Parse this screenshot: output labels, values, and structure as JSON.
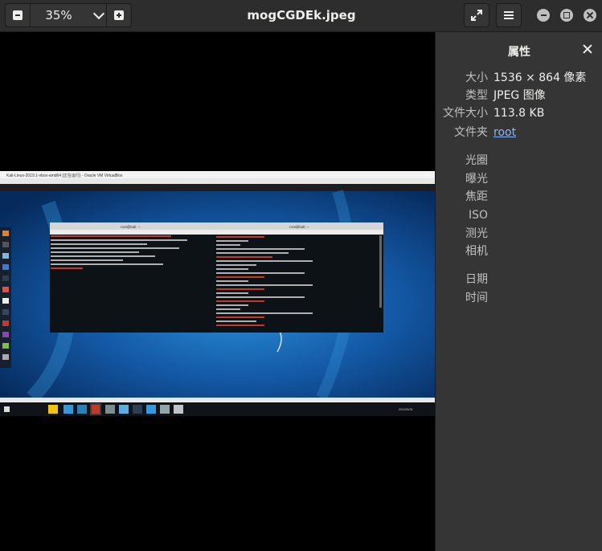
{
  "header": {
    "zoom_value": "35%",
    "title": "mogCGDEk.jpeg"
  },
  "sidebar": {
    "title": "属性",
    "props": [
      {
        "key": "大小",
        "value": "1536 × 864 像素"
      },
      {
        "key": "类型",
        "value": "JPEG 图像"
      },
      {
        "key": "文件大小",
        "value": "113.8 KB"
      },
      {
        "key": "文件夹",
        "value": "root"
      }
    ],
    "exif": [
      "光圈",
      "曝光",
      "焦距",
      "ISO",
      "测光",
      "相机"
    ],
    "time": [
      "日期",
      "时间"
    ]
  },
  "screenshot": {
    "vm_title": "Kali-Linux-2019.1-vbox-amd64 [正在运行] - Oracle VM VirtualBox",
    "term1_title": "root@kali: ~",
    "term2_title": "root@kali: ~",
    "clock": "2019/3/31"
  },
  "colors": {
    "header_bg": "#2d2d2d",
    "sidebar_bg": "#353535",
    "link": "#8cb4f2"
  }
}
